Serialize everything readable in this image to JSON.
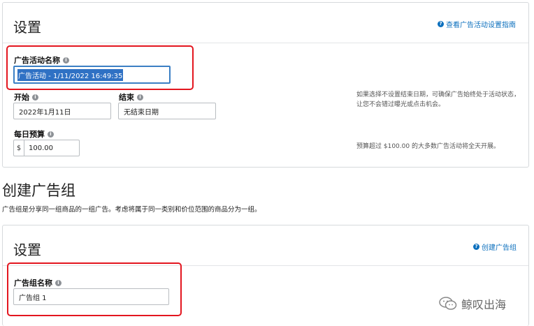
{
  "campaign_settings": {
    "title": "设置",
    "help_link": "查看广告活动设置指南",
    "name_label": "广告活动名称",
    "name_value": "广告活动 - 1/11/2022 16:49:35",
    "start_label": "开始",
    "start_value": "2022年1月11日",
    "end_label": "结束",
    "end_value": "无结束日期",
    "end_note": "如果选择不设置结束日期，可确保广告始终处于活动状态，让您不会错过曝光或点击机会。",
    "budget_label": "每日预算",
    "budget_currency": "$",
    "budget_value": "100.00",
    "budget_note": "预算超过 $100.00 的大多数广告活动将全天开展。"
  },
  "ad_group_section": {
    "heading": "创建广告组",
    "description": "广告组是分享同一组商品的一组广告。考虑将属于同一类别和价位范围的商品分为一组。"
  },
  "ad_group_settings": {
    "title": "设置",
    "help_link": "创建广告组",
    "name_label": "广告组名称",
    "name_value": "广告组 1"
  },
  "watermark": {
    "text": "鲸叹出海"
  },
  "colors": {
    "link": "#0b6fbd",
    "highlight_box": "#e3161f",
    "selection": "#2f71c4"
  }
}
